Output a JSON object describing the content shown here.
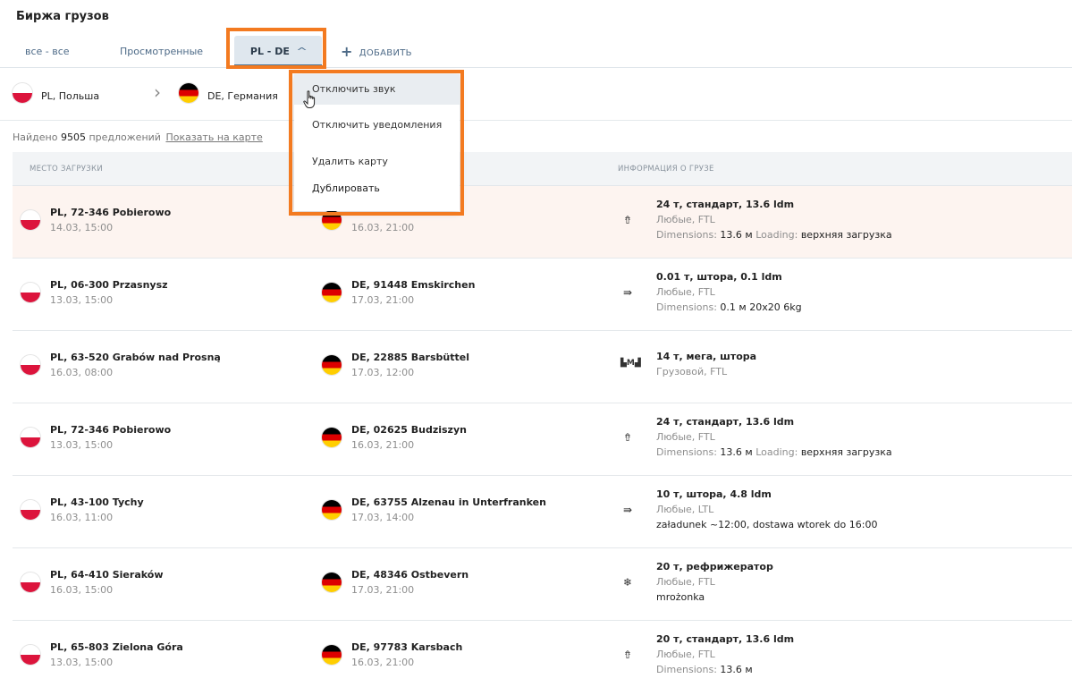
{
  "header": {
    "title": "Биржа грузов"
  },
  "tabs": {
    "all": "все - все",
    "viewed": "Просмотренные",
    "active": {
      "label": "PL - DE",
      "chevron": "chevron-up-icon"
    },
    "add": {
      "label": "ДОБАВИТЬ",
      "icon": "plus-icon"
    }
  },
  "route": {
    "from": {
      "flag": "PL",
      "label": "PL, Польша"
    },
    "to": {
      "flag": "DE",
      "label": "DE, Германия"
    }
  },
  "results": {
    "found_prefix": "Найдено",
    "count": "9505",
    "suffix": "предложений",
    "map_link": "Показать на карте"
  },
  "table": {
    "headers": {
      "load": "МЕСТО ЗАГРУЗКИ",
      "unload": "",
      "info": "ИНФОРМАЦИЯ О ГРУЗЕ"
    },
    "rows": [
      {
        "from_place": "PL, 72-346 Pobierowo",
        "from_date": "14.03, 15:00",
        "to_place": "",
        "to_date": "16.03, 21:00",
        "icon": "top-loading-icon",
        "cargo_main": "24 т, стандарт, 13.6 ldm",
        "cargo_sub": "Любые, FTL",
        "extra_label1": "Dimensions:",
        "extra_value1": "13.6 м",
        "extra_label2": "Loading:",
        "extra_value2": "верхняя загрузка"
      },
      {
        "from_place": "PL, 06-300 Przasnysz",
        "from_date": "13.03, 15:00",
        "to_place": "DE, 91448 Emskirchen",
        "to_date": "17.03, 21:00",
        "icon": "side-loading-icon",
        "cargo_main": "0.01 т, штора, 0.1 ldm",
        "cargo_sub": "Любые, FTL",
        "extra_label1": "Dimensions:",
        "extra_value1": "0.1 м 20x20 6kg",
        "extra_label2": "",
        "extra_value2": ""
      },
      {
        "from_place": "PL, 63-520 Grabów nad Prosną",
        "from_date": "16.03, 08:00",
        "to_place": "DE, 22885 Barsbüttel",
        "to_date": "17.03, 12:00",
        "icon": "mega-trailer-icon",
        "cargo_main": "14 т, мега, штора",
        "cargo_sub": "Грузовой, FTL",
        "extra_label1": "",
        "extra_value1": "",
        "extra_label2": "",
        "extra_value2": ""
      },
      {
        "from_place": "PL, 72-346 Pobierowo",
        "from_date": "13.03, 15:00",
        "to_place": "DE, 02625 Budziszyn",
        "to_date": "16.03, 21:00",
        "icon": "top-loading-icon",
        "cargo_main": "24 т, стандарт, 13.6 ldm",
        "cargo_sub": "Любые, FTL",
        "extra_label1": "Dimensions:",
        "extra_value1": "13.6 м",
        "extra_label2": "Loading:",
        "extra_value2": "верхняя загрузка"
      },
      {
        "from_place": "PL, 43-100 Tychy",
        "from_date": "16.03, 11:00",
        "to_place": "DE, 63755 Alzenau in Unterfranken",
        "to_date": "17.03, 14:00",
        "icon": "side-loading-icon",
        "cargo_main": "10 т, штора, 4.8 ldm",
        "cargo_sub": "Любые, LTL",
        "extra_label1": "",
        "extra_value1": "załadunek ~12:00, dostawa wtorek do 16:00",
        "extra_label2": "",
        "extra_value2": ""
      },
      {
        "from_place": "PL, 64-410 Sieraków",
        "from_date": "16.03, 15:00",
        "to_place": "DE, 48346 Ostbevern",
        "to_date": "17.03, 21:00",
        "icon": "snowflake-icon",
        "cargo_main": "20 т, рефрижератор",
        "cargo_sub": "Любые, FTL",
        "extra_label1": "",
        "extra_value1": "mrożonka",
        "extra_label2": "",
        "extra_value2": ""
      },
      {
        "from_place": "PL, 65-803 Zielona Góra",
        "from_date": "13.03, 15:00",
        "to_place": "DE, 97783 Karsbach",
        "to_date": "16.03, 21:00",
        "icon": "top-loading-icon",
        "cargo_main": "20 т, стандарт, 13.6 ldm",
        "cargo_sub": "Любые, FTL",
        "extra_label1": "Dimensions:",
        "extra_value1": "13.6 м",
        "extra_label2": "",
        "extra_value2": ""
      }
    ]
  },
  "menu": {
    "items": [
      "Отключить звук",
      "Отключить уведомления",
      "Удалить карту",
      "Дублировать"
    ]
  },
  "colors": {
    "highlight": "#f37a20",
    "active_tab": "#dfe7ee",
    "row_highlight": "#fdf4f0"
  }
}
